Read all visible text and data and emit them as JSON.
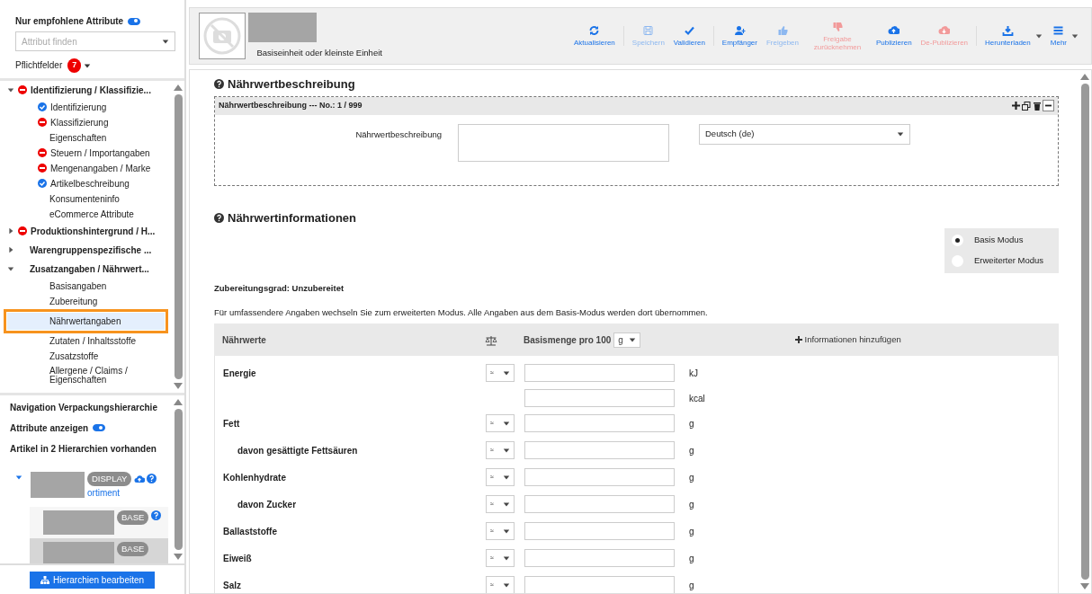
{
  "sidebar": {
    "recommended_only": {
      "label": "Nur empfohlene Attribute",
      "on": true
    },
    "attribute_search": {
      "placeholder": "Attribut finden"
    },
    "required_fields": {
      "label": "Pflichtfelder",
      "count": "7"
    },
    "tree": [
      {
        "label": "Identifizierung / Klassifizie...",
        "error": true,
        "valid": false,
        "expanded": true,
        "children": [
          {
            "label": "Identifizierung",
            "error": false,
            "valid": true,
            "selected": false
          },
          {
            "label": "Klassifizierung",
            "error": true,
            "valid": false,
            "selected": false
          },
          {
            "label": "Eigenschaften",
            "error": false,
            "valid": false,
            "selected": false
          },
          {
            "label": "Steuern / Importangaben",
            "error": true,
            "valid": false,
            "selected": false
          },
          {
            "label": "Mengenangaben / Marke",
            "error": true,
            "valid": false,
            "selected": false
          },
          {
            "label": "Artikelbeschreibung",
            "error": false,
            "valid": true,
            "selected": false
          },
          {
            "label": "Konsumenteninfo",
            "error": false,
            "valid": false,
            "selected": false
          },
          {
            "label": "eCommerce Attribute",
            "error": false,
            "valid": false,
            "selected": false
          }
        ]
      },
      {
        "label": "Produktionshintergrund / H...",
        "error": true,
        "valid": false,
        "expanded": false
      },
      {
        "label": "Warengruppenspezifische ...",
        "error": false,
        "valid": false,
        "expanded": false
      },
      {
        "label": "Zusatzangaben / Nährwert...",
        "error": false,
        "valid": false,
        "expanded": true,
        "children": [
          {
            "label": "Basisangaben",
            "error": false,
            "valid": false,
            "selected": false
          },
          {
            "label": "Zubereitung",
            "error": false,
            "valid": false,
            "selected": false
          },
          {
            "label": "Nährwertangaben",
            "error": false,
            "valid": false,
            "selected": true
          },
          {
            "label": "Zutaten / Inhaltsstoffe",
            "error": false,
            "valid": false,
            "selected": false
          },
          {
            "label": "Zusatzstoffe",
            "error": false,
            "valid": false,
            "selected": false
          },
          {
            "label": "Allergene / Claims / Eigenschaften",
            "error": false,
            "valid": false,
            "selected": false
          }
        ]
      }
    ],
    "hierarchy": {
      "title": "Navigation Verpackungshierarchie",
      "show_attributes": {
        "label": "Attribute anzeigen",
        "on": true
      },
      "summary": "Artikel in 2 Hierarchien vorhanden",
      "nodes": [
        {
          "badge": "DISPLAY",
          "link": "ortiment",
          "cloud": true,
          "help": true,
          "expanded": true,
          "selected": false,
          "children": [
            {
              "badge": "BASE",
              "cloud": false,
              "help": true,
              "selected": false
            },
            {
              "badge": "BASE",
              "cloud": false,
              "help": false,
              "selected": true
            }
          ]
        }
      ],
      "edit_button": "Hierarchien bearbeiten"
    }
  },
  "product": {
    "subtitle": "Basiseinheit oder kleinste Einheit"
  },
  "toolbar": [
    {
      "kind": "refresh",
      "label": "Aktualisieren",
      "danger": false,
      "disabled": false,
      "dropdown": false,
      "separator_after": true
    },
    {
      "kind": "save",
      "label": "Speichern",
      "danger": false,
      "disabled": true,
      "dropdown": false,
      "separator_after": false
    },
    {
      "kind": "check",
      "label": "Validieren",
      "danger": false,
      "disabled": false,
      "dropdown": false,
      "separator_after": true
    },
    {
      "kind": "user",
      "label": "Empfänger",
      "danger": false,
      "disabled": false,
      "dropdown": false,
      "separator_after": false
    },
    {
      "kind": "thumb-up",
      "label": "Freigeben",
      "danger": false,
      "disabled": true,
      "dropdown": false,
      "separator_after": false
    },
    {
      "kind": "thumb-down",
      "label": "Freigabe zurücknehmen",
      "danger": true,
      "disabled": true,
      "dropdown": false,
      "separator_after": false
    },
    {
      "kind": "upload",
      "label": "Publizieren",
      "danger": false,
      "disabled": false,
      "dropdown": false,
      "separator_after": false
    },
    {
      "kind": "unpublish",
      "label": "De-Publizieren",
      "danger": true,
      "disabled": true,
      "dropdown": false,
      "separator_after": true
    },
    {
      "kind": "download",
      "label": "Herunterladen",
      "danger": false,
      "disabled": false,
      "dropdown": true,
      "separator_after": false
    },
    {
      "kind": "menu",
      "label": "Mehr",
      "danger": false,
      "disabled": false,
      "dropdown": true,
      "separator_after": false
    }
  ],
  "description_section": {
    "title": "Nährwertbeschreibung",
    "block": {
      "title": "Nährwertbeschreibung --- No.: 1 / 999",
      "field_label": "Nährwertbeschreibung",
      "language": "Deutsch (de)"
    }
  },
  "info_section": {
    "title": "Nährwertinformationen",
    "modes": [
      {
        "label": "Basis Modus",
        "selected": true
      },
      {
        "label": "Erweiterter Modus",
        "selected": false
      }
    ],
    "preparation": "Zubereitungsgrad: Unzubereitet",
    "hint": "Für umfassendere Angaben wechseln Sie zum erweiterten Modus. Alle Angaben aus dem Basis-Modus werden dort übernommen.",
    "table": {
      "columns": {
        "name": "Nährwerte",
        "base": "Basismenge pro 100",
        "base_unit": "g",
        "add": "Informationen hinzufügen"
      },
      "rows": [
        {
          "name": "Energie",
          "operator": "≈",
          "units": [
            "kJ",
            "kcal"
          ]
        },
        {
          "name": "Fett",
          "operator": "≈",
          "units": [
            "g"
          ],
          "children": [
            {
              "name": "davon gesättigte Fettsäuren",
              "operator": "≈",
              "units": [
                "g"
              ]
            }
          ]
        },
        {
          "name": "Kohlenhydrate",
          "operator": "≈",
          "units": [
            "g"
          ],
          "children": [
            {
              "name": "davon Zucker",
              "operator": "≈",
              "units": [
                "g"
              ]
            }
          ]
        },
        {
          "name": "Ballaststoffe",
          "operator": "≈",
          "units": [
            "g"
          ]
        },
        {
          "name": "Eiweiß",
          "operator": "≈",
          "units": [
            "g"
          ]
        },
        {
          "name": "Salz",
          "operator": "≈",
          "units": [
            "g"
          ]
        }
      ]
    }
  }
}
